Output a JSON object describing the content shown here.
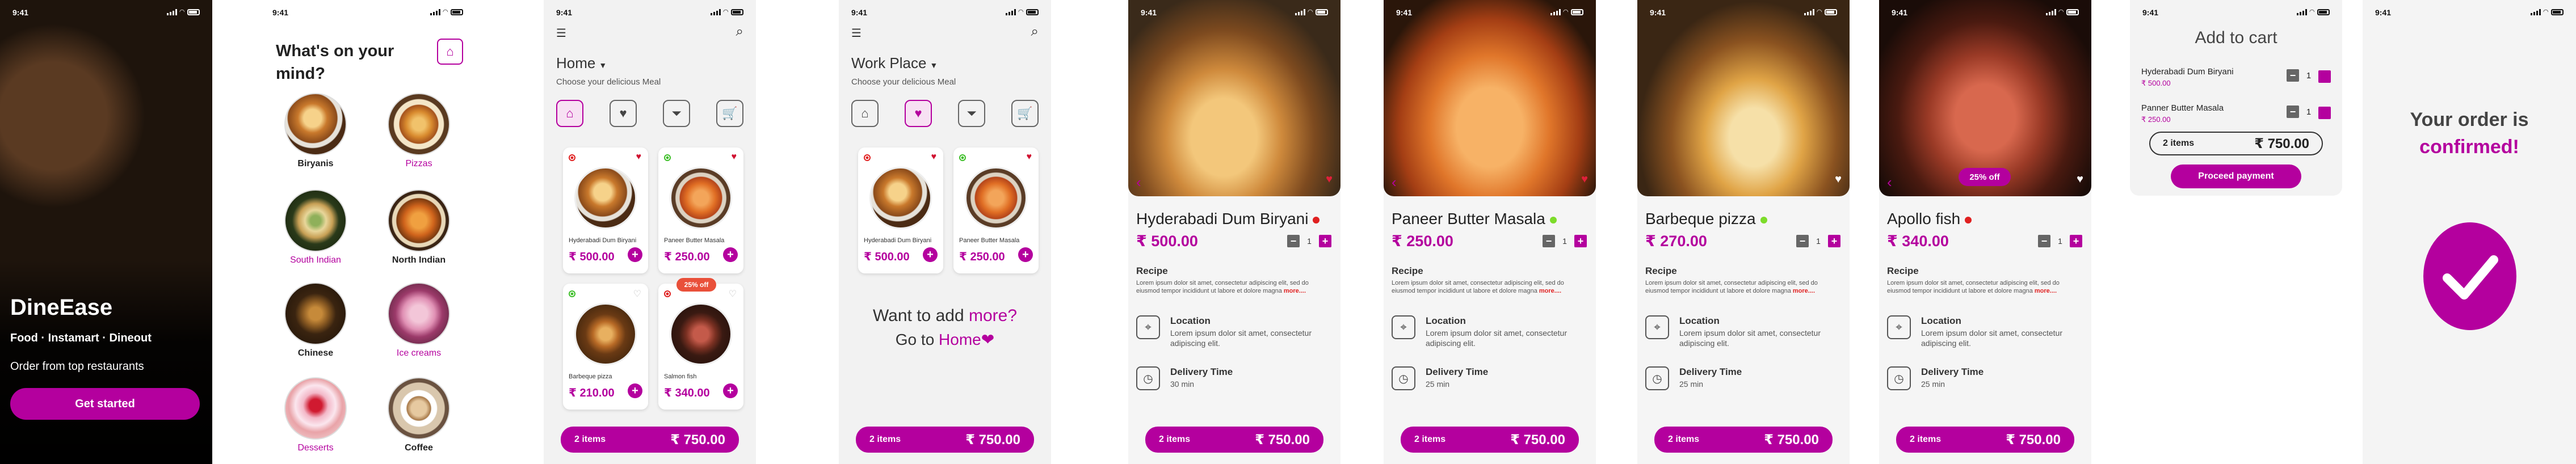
{
  "status_time": "9:41",
  "accent": "#b4009e",
  "welcome": {
    "brand": "DineEase",
    "tagline": "Food · Instamart · Dineout",
    "subtitle": "Order from top restaurants",
    "cta": "Get started"
  },
  "categories_screen": {
    "title": "What's on your mind?",
    "home_icon": "home-icon",
    "items": [
      {
        "label": "Biryanis",
        "highlight": false
      },
      {
        "label": "Pizzas",
        "highlight": true
      },
      {
        "label": "South Indian",
        "highlight": true
      },
      {
        "label": "North Indian",
        "highlight": false
      },
      {
        "label": "Chinese",
        "highlight": false
      },
      {
        "label": "Ice creams",
        "highlight": true
      },
      {
        "label": "Desserts",
        "highlight": true
      },
      {
        "label": "Coffee",
        "highlight": false
      }
    ]
  },
  "home_screen": {
    "location": "Home",
    "location_sub": "Choose your delicious Meal",
    "filters": [
      "home-icon",
      "heart-icon",
      "filter-icon",
      "cart-icon"
    ],
    "active_filter": 0,
    "cards": [
      {
        "name": "Hyderabadi Dum Biryani",
        "price": "₹ 500.00",
        "veg": false,
        "fav": true,
        "offer": ""
      },
      {
        "name": "Paneer Butter Masala",
        "price": "₹ 250.00",
        "veg": true,
        "fav": true,
        "offer": ""
      },
      {
        "name": "Barbeque pizza",
        "price": "₹ 210.00",
        "veg": true,
        "fav": false,
        "offer": ""
      },
      {
        "name": "Salmon fish",
        "price": "₹ 340.00",
        "veg": false,
        "fav": false,
        "offer": "25% off"
      }
    ]
  },
  "work_screen": {
    "location": "Work Place",
    "location_sub": "Choose your delicious Meal",
    "active_filter": 1,
    "cards": [
      {
        "name": "Hyderabadi Dum Biryani",
        "price": "₹ 500.00",
        "veg": false,
        "fav": true
      },
      {
        "name": "Paneer Butter Masala",
        "price": "₹ 250.00",
        "veg": true,
        "fav": true
      }
    ],
    "empty_line1_a": "Want to add ",
    "empty_line1_b": "more?",
    "empty_line2_a": "Go to ",
    "empty_line2_b": "Home"
  },
  "cart_bar": {
    "items": "2 items",
    "total": "₹ 750.00"
  },
  "details": [
    {
      "name": "Hyderabadi Dum Biryani",
      "veg": false,
      "price": "₹ 500.00",
      "qty": "1",
      "offer": ""
    },
    {
      "name": "Paneer Butter Masala",
      "veg": true,
      "price": "₹ 250.00",
      "qty": "1",
      "offer": ""
    },
    {
      "name": "Barbeque pizza",
      "veg": true,
      "price": "₹ 270.00",
      "qty": "1",
      "offer": ""
    },
    {
      "name": "Apollo fish",
      "veg": false,
      "price": "₹ 340.00",
      "qty": "1",
      "offer": "25% off"
    }
  ],
  "detail_common": {
    "recipe_title": "Recipe",
    "recipe_text": "Lorem ipsum dolor sit amet, consectetur adipiscing elit, sed do eiusmod tempor incididunt ut labore et dolore magna ",
    "recipe_more": "more....",
    "location_title": "Location",
    "location_text": "Lorem ipsum dolor sit amet, consectetur adipiscing elit.",
    "delivery_title": "Delivery Time"
  },
  "delivery_times": [
    "30 min",
    "25 min",
    "25 min",
    "25 min"
  ],
  "cart": {
    "title": "Add to cart",
    "items": [
      {
        "name": "Hyderabadi Dum Biryani",
        "price": "₹ 500.00",
        "qty": "1"
      },
      {
        "name": "Panner Butter Masala",
        "price": "₹ 250.00",
        "qty": "1"
      }
    ],
    "total_items": "2 items",
    "total": "₹ 750.00",
    "pay": "Proceed payment"
  },
  "confirm": {
    "line1": "Your order is",
    "line2": "confirmed!"
  }
}
